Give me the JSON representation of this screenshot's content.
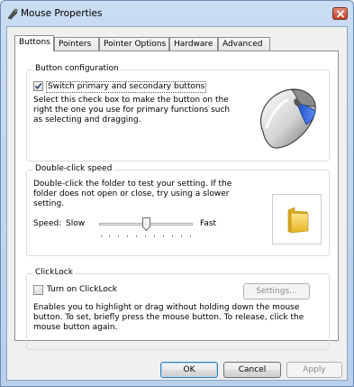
{
  "window": {
    "title": "Mouse Properties"
  },
  "tabs": [
    {
      "label": "Buttons",
      "active": true
    },
    {
      "label": "Pointers"
    },
    {
      "label": "Pointer Options"
    },
    {
      "label": "Hardware"
    },
    {
      "label": "Advanced"
    }
  ],
  "button_config": {
    "group_title": "Button configuration",
    "checkbox_label": "Switch primary and secondary buttons",
    "checked": true,
    "description_lines": [
      "Select this check box to make the button on the",
      "right the one you use for primary functions such",
      "as selecting and dragging."
    ]
  },
  "double_click": {
    "group_title": "Double-click speed",
    "description_lines": [
      "Double-click the folder to test your setting. If the",
      "folder does not open or close, try using a slower",
      "setting."
    ],
    "speed_label": "Speed:",
    "slow_label": "Slow",
    "fast_label": "Fast",
    "speed_level": 0.5
  },
  "clicklock": {
    "group_title": "ClickLock",
    "checkbox_label": "Turn on ClickLock",
    "checked": false,
    "settings_button": "Settings...",
    "description_lines": [
      "Enables you to highlight or drag without holding down the mouse",
      "button. To set, briefly press the mouse button. To release, click the",
      "mouse button again."
    ]
  },
  "footer": {
    "ok": "OK",
    "cancel": "Cancel",
    "apply": "Apply"
  },
  "icons": {
    "title": "mouse-pointer-icon",
    "close": "close-icon",
    "folder": "folder-icon",
    "mouse": "mouse-illustration"
  },
  "colors": {
    "accent": "#3c7fb1",
    "close": "#c0402a",
    "folder": "#f3c93d"
  }
}
